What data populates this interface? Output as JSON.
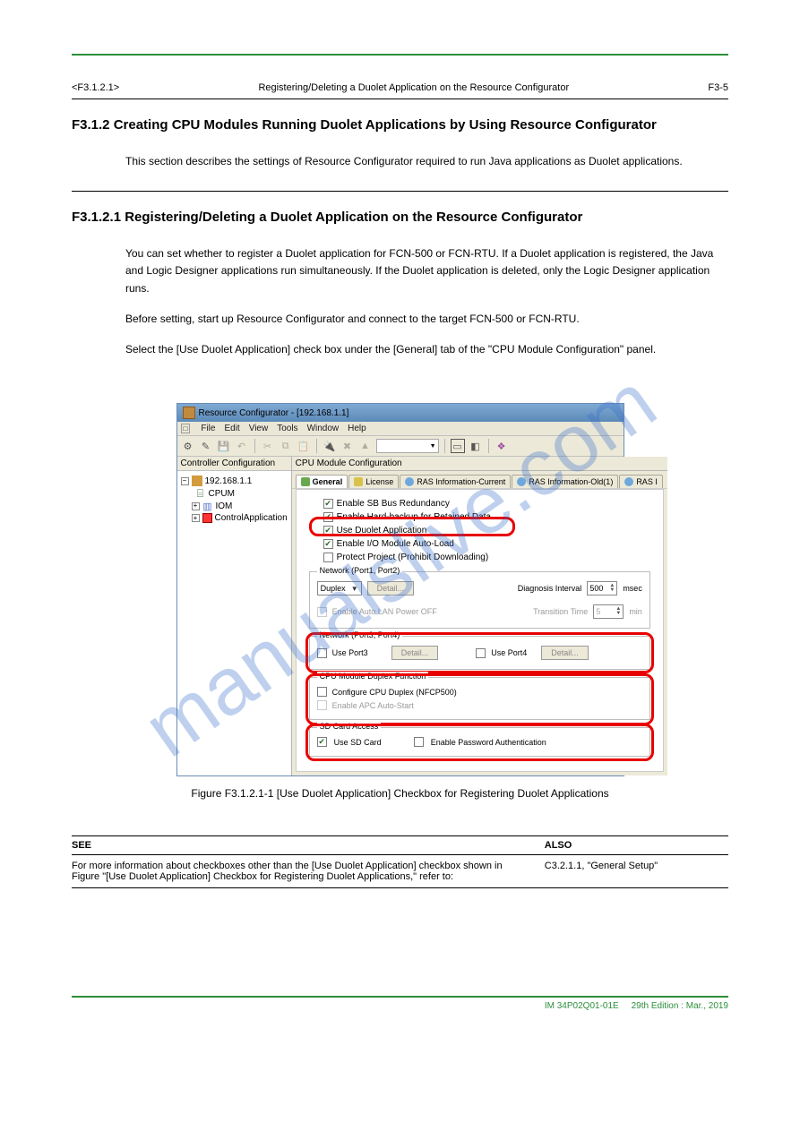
{
  "page_meta": {
    "doc_id": "<F3.1.2.1>",
    "doc_title": "Registering/Deleting a Duolet Application on the Resource Configurator",
    "page_no": "F3-5"
  },
  "intro": {
    "heading": "F3.1.2 Creating CPU Modules Running Duolet Applications by Using Resource Configurator",
    "body": "This section describes the settings of Resource Configurator required to run Java applications as Duolet applications."
  },
  "step1": {
    "heading": "F3.1.2.1 Registering/Deleting a Duolet Application on the Resource Configurator",
    "body1": "You can set whether to register a Duolet application for FCN-500 or FCN-RTU. If a Duolet application is registered, the Java and Logic Designer applications run simultaneously. If the Duolet application is deleted, only the Logic Designer application runs.",
    "body2": "Before setting, start up Resource Configurator and connect to the target FCN-500 or FCN-RTU.",
    "body3": "Select the [Use Duolet Application] check box under the [General] tab of the \"CPU Module Configuration\" panel."
  },
  "screenshot": {
    "title": "Resource Configurator - [192.168.1.1]",
    "menubar": {
      "items": [
        "File",
        "Edit",
        "View",
        "Tools",
        "Window",
        "Help"
      ]
    },
    "tree": {
      "title": "Controller Configuration",
      "root": "192.168.1.1",
      "children": [
        "CPUM",
        "IOM",
        "ControlApplication"
      ]
    },
    "panel_title": "CPU Module Configuration",
    "tabs": [
      "General",
      "License",
      "RAS Information-Current",
      "RAS Information-Old(1)",
      "RAS I"
    ],
    "checks": {
      "sb_bus": "Enable SB Bus Redundancy",
      "hard_backup": "Enable Hard-backup for Retained Data",
      "duolet": "Use Duolet Application",
      "io_auto": "Enable I/O Module Auto-Load",
      "protect": "Protect Project (Prohibit Downloading)"
    },
    "net12": {
      "legend": "Network (Port1, Port2)",
      "mode": "Duplex",
      "detail": "Detail...",
      "diag_lbl": "Diagnosis Interval",
      "diag_val": "500",
      "diag_unit": "msec",
      "auto_off": "Enable Auto LAN Power OFF",
      "trans_lbl": "Transition Time",
      "trans_val": "5",
      "trans_unit": "min"
    },
    "net34": {
      "legend": "Network (Port3, Port4)",
      "use3": "Use Port3",
      "use4": "Use Port4",
      "detail": "Detail..."
    },
    "duplex": {
      "legend": "CPU Module Duplex Function",
      "cfg": "Configure CPU Duplex (NFCP500)",
      "apc": "Enable APC Auto-Start"
    },
    "sd": {
      "legend": "SD Card Access",
      "use": "Use SD Card",
      "pwd": "Enable Password Authentication"
    }
  },
  "fig_caption": "Figure F3.1.2.1-1 [Use Duolet Application] Checkbox for Registering Duolet Applications",
  "see_also": {
    "head_left": "SEE",
    "head_right": "ALSO",
    "cell_left": "For more information about checkboxes other than the [Use Duolet Application] checkbox shown in Figure \"[Use Duolet Application] Checkbox for Registering Duolet Applications,\" refer to:",
    "cell_right": "C3.2.1.1, \"General Setup\""
  },
  "footer": {
    "left": "IM 34P02Q01-01E",
    "right": "29th Edition : Mar., 2019"
  }
}
